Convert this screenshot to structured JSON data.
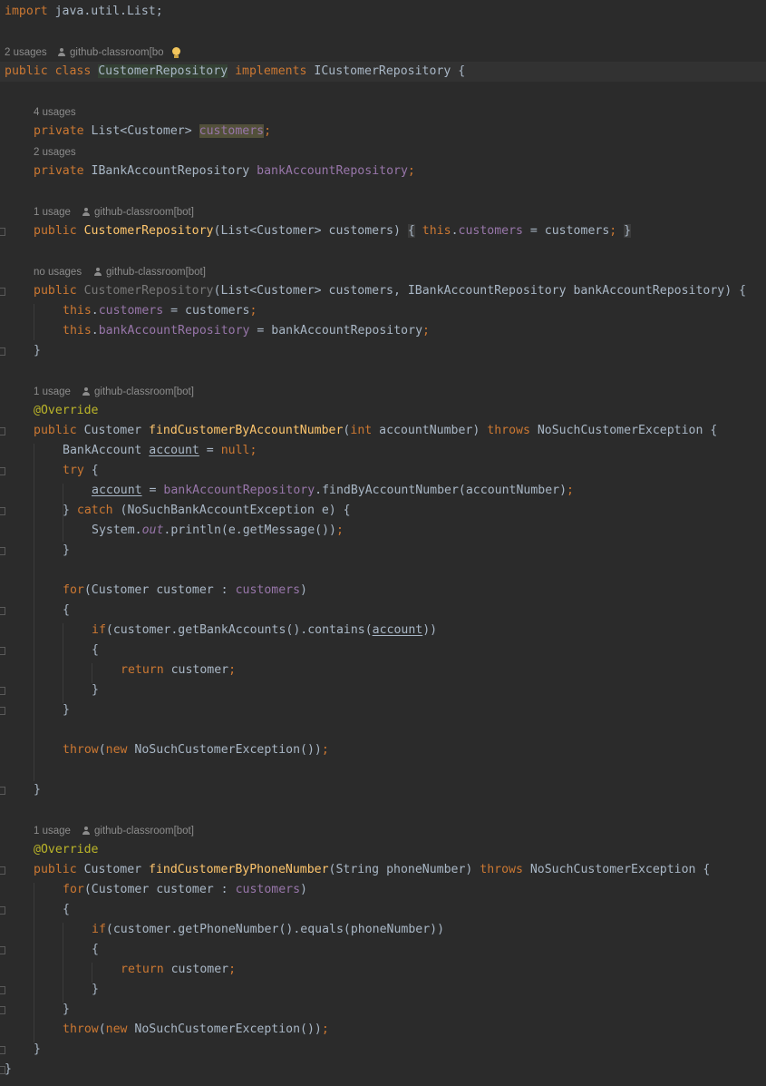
{
  "editor": {
    "language": "java",
    "colors": {
      "background": "#2b2b2b",
      "keyword": "#cc7832",
      "field": "#9876aa",
      "method": "#ffc66d",
      "annotation": "#bbb529",
      "text": "#a9b7c6",
      "hint": "#8c8c8c"
    },
    "hints": {
      "h0_usage": "2 usages",
      "h0_author": "github-classroom[bo",
      "h1_usage": "4 usages",
      "h2_usage": "2 usages",
      "h3_usage": "1 usage",
      "h3_author": "github-classroom[bot]",
      "h4_usage": "no usages",
      "h4_author": "github-classroom[bot]",
      "h5_usage": "1 usage",
      "h5_author": "github-classroom[bot]",
      "h6_usage": "1 usage",
      "h6_author": "github-classroom[bot]"
    },
    "code": {
      "import": {
        "kw": "import",
        "path": " java.util.List;"
      },
      "class_decl": {
        "kw": "public class ",
        "name": "CustomerRepository",
        "kw2": " implements ",
        "iface": "ICustomerRepository {"
      },
      "field1": {
        "kw": "private ",
        "type": "List<Customer> ",
        "name": "customers",
        "semi": ";"
      },
      "field2": {
        "kw": "private ",
        "type": "IBankAccountRepository ",
        "name": "bankAccountRepository",
        "semi": ";"
      },
      "ctor1": {
        "kw": "public ",
        "name": "CustomerRepository",
        "params": "(List<Customer> customers)",
        "ob": "{",
        "kw2": "this",
        "dot": ".",
        "field": "customers",
        "eq": " = customers",
        "semi": ";",
        "cb": "}"
      },
      "ctor2": {
        "kw": "public ",
        "name": "CustomerRepository",
        "params": "(List<Customer> customers, IBankAccountRepository bankAccountRepository) {"
      },
      "ctor2_l1": {
        "kw": "this",
        "dot": ".",
        "field": "customers",
        "eq": " = customers",
        "semi": ";"
      },
      "ctor2_l2": {
        "kw": "this",
        "dot": ".",
        "field": "bankAccountRepository",
        "eq": " = bankAccountRepository",
        "semi": ";"
      },
      "close_brace": "}",
      "override": "@Override",
      "m1_sig": {
        "kw": "public ",
        "type": "Customer ",
        "name": "findCustomerByAccountNumber",
        "p1": "(",
        "ptype": "int",
        "p2": " accountNumber) ",
        "kw2": "throws",
        "rest": " NoSuchCustomerException {"
      },
      "m1_l1": {
        "type": "BankAccount ",
        "var": "account",
        "eq": " = ",
        "kw": "null",
        "semi": ";"
      },
      "m1_try": {
        "kw": "try",
        "rest": " {"
      },
      "m1_l2": {
        "var": "account",
        "eq": " = ",
        "field": "bankAccountRepository",
        "call": ".findByAccountNumber(accountNumber)",
        "semi": ";"
      },
      "m1_catch": {
        "pre": "} ",
        "kw": "catch",
        "rest": " (NoSuchBankAccountException e) {"
      },
      "m1_l3": {
        "pre": "System.",
        "static": "out",
        "rest": ".println(e.getMessage())",
        "semi": ";"
      },
      "m1_for": {
        "kw": "for",
        "pre": "(Customer customer : ",
        "field": "customers",
        "post": ")"
      },
      "open_brace": "{",
      "m1_if": {
        "kw": "if",
        "pre": "(customer.getBankAccounts().contains(",
        "var": "account",
        "post": "))"
      },
      "ret": {
        "kw": "return",
        "rest": " customer",
        "semi": ";"
      },
      "throw_line": {
        "kw": "throw",
        "p": "(",
        "kw2": "new",
        "rest": " NoSuchCustomerException())",
        "semi": ";"
      },
      "m2_sig": {
        "kw": "public ",
        "type": "Customer ",
        "name": "findCustomerByPhoneNumber",
        "params": "(String phoneNumber) ",
        "kw2": "throws",
        "rest": " NoSuchCustomerException {"
      },
      "m2_if": {
        "kw": "if",
        "rest": "(customer.getPhoneNumber().equals(phoneNumber))"
      }
    }
  }
}
